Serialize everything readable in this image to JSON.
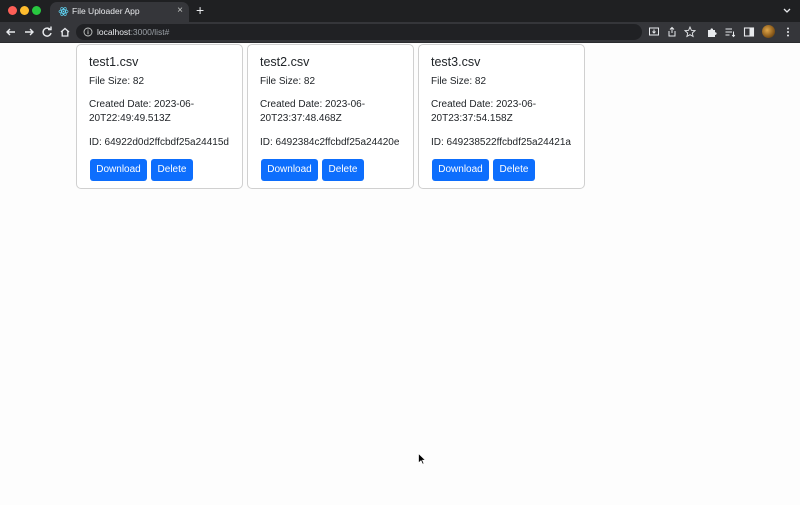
{
  "browser": {
    "tab_title": "File Uploader App",
    "tab_close": "×",
    "new_tab": "+",
    "url_host": "localhost",
    "url_rest": ":3000/list#"
  },
  "cards": [
    {
      "title": "test1.csv",
      "file_size": "File Size: 82",
      "created_date": "Created Date: 2023-06-20T22:49:49.513Z",
      "id": "ID: 64922d0d2ffcbdf25a24415d",
      "download_label": "Download",
      "delete_label": "Delete"
    },
    {
      "title": "test2.csv",
      "file_size": "File Size: 82",
      "created_date": "Created Date: 2023-06-20T23:37:48.468Z",
      "id": "ID: 6492384c2ffcbdf25a24420e",
      "download_label": "Download",
      "delete_label": "Delete"
    },
    {
      "title": "test3.csv",
      "file_size": "File Size: 82",
      "created_date": "Created Date: 2023-06-20T23:37:54.158Z",
      "id": "ID: 649238522ffcbdf25a24421a",
      "download_label": "Download",
      "delete_label": "Delete"
    }
  ],
  "colors": {
    "primary_button": "#0d6efd",
    "browser_frame": "#1f2022",
    "browser_toolbar": "#35363a"
  },
  "icons": [
    "react-icon",
    "back-arrow-icon",
    "forward-arrow-icon",
    "reload-icon",
    "home-icon",
    "info-icon",
    "install-icon",
    "share-icon",
    "star-icon",
    "extensions-icon",
    "reading-list-icon",
    "side-panel-icon",
    "profile-avatar",
    "menu-icon",
    "mouse-cursor"
  ]
}
